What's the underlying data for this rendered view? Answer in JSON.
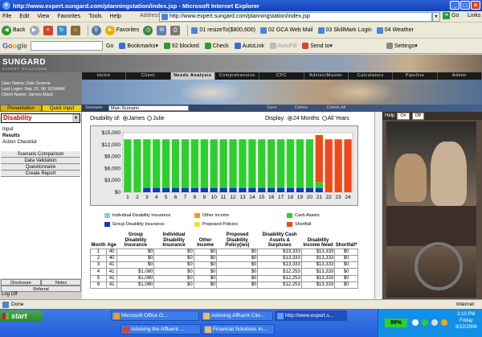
{
  "window": {
    "title": "http://www.expert.sungard.com/planningstation/index.jsp - Microsoft Internet Explorer"
  },
  "menu": [
    "File",
    "Edit",
    "View",
    "Favorites",
    "Tools",
    "Help"
  ],
  "address": {
    "label": "Address",
    "url": "http://www.expert.sungard.com/planningstation/index.jsp",
    "go": "Go",
    "links": "Links"
  },
  "toolbar": {
    "back": "Back",
    "favorites": "Favorites",
    "links": [
      "01 resizeTo($800,600)",
      "02 GCA Web Mail",
      "03 SkillMark Login",
      "04 Weather"
    ]
  },
  "googlebar": {
    "logo": [
      "G",
      "o",
      "o",
      "g",
      "l",
      "e"
    ],
    "go": "Go",
    "bookmarks": "Bookmarks▾",
    "blocked": "92 blocked",
    "check": "Check",
    "autolink": "AutoLink",
    "autofill": "AutoFill",
    "sendto": "Send to▾",
    "settings": "Settings▾"
  },
  "app": {
    "logo": "SUNGARD",
    "logo_sub": "EXPERT SOLUTIONS",
    "user": [
      "User Name: Dan Greene",
      "Last Login: Sep 22, 06 10:54AM",
      "Client Name: James Mack"
    ],
    "nav_tabs": [
      "Home",
      "Client",
      "Needs Analysis",
      "Comprehensive",
      "CPC",
      "AdvisorMaster",
      "Calculators",
      "Pipeline",
      "Admin"
    ],
    "active_nav": "Needs Analysis",
    "sub_tabs": {
      "presentation": "Presentation",
      "quick_input": "Quick Input"
    },
    "scenario": {
      "label": "Scenario",
      "value": "Main Scenario",
      "buttons": [
        "Save",
        "Delete",
        "Delete All"
      ]
    },
    "left_nav": {
      "module": "Disability",
      "items": [
        "Input",
        "Results",
        "Action Checklist"
      ],
      "buttons": [
        "Scenario Comparison",
        "Data Validation",
        "Questionnaire",
        "Create Report"
      ],
      "bottom": {
        "disclosure": "Disclosure",
        "notes": "Notes",
        "referral": "Referral",
        "logoff": "Log Off"
      }
    },
    "controls": {
      "disability_of": "Disability of:",
      "person1": "James",
      "person2": "Julie",
      "display": "Display:",
      "opt1": "24 Months",
      "opt2": "All Years"
    },
    "help": {
      "label": "Help",
      "on": "On",
      "off": "Off"
    }
  },
  "chart_data": {
    "type": "bar",
    "stacked": true,
    "categories": [
      "1",
      "2",
      "3",
      "4",
      "5",
      "6",
      "7",
      "8",
      "9",
      "10",
      "11",
      "12",
      "13",
      "14",
      "15",
      "16",
      "17",
      "18",
      "19",
      "20",
      "21",
      "22",
      "23",
      "24"
    ],
    "series": [
      {
        "name": "Individual Disability Insurance",
        "color": "#88c8f0",
        "values": [
          0,
          0,
          0,
          0,
          0,
          0,
          0,
          0,
          0,
          0,
          0,
          0,
          0,
          0,
          0,
          0,
          0,
          0,
          0,
          0,
          0,
          0,
          0,
          0
        ]
      },
      {
        "name": "Group Disability Insurance",
        "color": "#1038c0",
        "values": [
          0,
          0,
          1080,
          1080,
          1080,
          1080,
          1080,
          1080,
          1080,
          1080,
          1080,
          1080,
          1080,
          1080,
          1080,
          1080,
          1080,
          1080,
          1080,
          1080,
          1080,
          0,
          0,
          0
        ]
      },
      {
        "name": "Other Income",
        "color": "#e8a020",
        "values": [
          0,
          0,
          0,
          0,
          0,
          0,
          0,
          0,
          0,
          0,
          0,
          0,
          0,
          0,
          0,
          0,
          0,
          0,
          0,
          0,
          0,
          0,
          0,
          0
        ]
      },
      {
        "name": "Proposed Policies",
        "color": "#f0e040",
        "values": [
          0,
          0,
          0,
          0,
          0,
          0,
          0,
          0,
          0,
          0,
          0,
          0,
          0,
          0,
          0,
          0,
          0,
          0,
          0,
          0,
          0,
          0,
          0,
          0
        ]
      },
      {
        "name": "Cash Assets",
        "color": "#2cd02c",
        "values": [
          13333,
          13333,
          12253,
          12253,
          12253,
          12253,
          12253,
          12253,
          12253,
          12253,
          12253,
          12253,
          12253,
          12253,
          12253,
          12253,
          12253,
          12253,
          12253,
          12253,
          1500,
          0,
          0,
          0
        ]
      },
      {
        "name": "Shortfall",
        "color": "#f04818",
        "values": [
          0,
          0,
          0,
          0,
          0,
          0,
          0,
          0,
          0,
          0,
          0,
          0,
          0,
          0,
          0,
          0,
          0,
          0,
          0,
          0,
          11833,
          13333,
          13333,
          13333
        ]
      }
    ],
    "yticks": [
      "$15,000",
      "$12,000",
      "$9,000",
      "$6,000",
      "$3,000",
      "$0"
    ],
    "ylim": [
      0,
      15000
    ],
    "legend_position": "bottom",
    "grid": true,
    "table": {
      "headers": [
        "Month",
        "Age",
        "Group Disability Insurance",
        "Individual Disability Insurance",
        "Other Income",
        "Proposed Disability Policy(ies)",
        "Disability Cash Assets & Surpluses",
        "Disability Income Need",
        "Shortfall*"
      ],
      "rows": [
        [
          "1",
          "40",
          "$0",
          "$0",
          "$0",
          "$0",
          "$13,333",
          "$13,333",
          "$0"
        ],
        [
          "2",
          "40",
          "$0",
          "$0",
          "$0",
          "$0",
          "$13,333",
          "$13,333",
          "$0"
        ],
        [
          "3",
          "41",
          "$0",
          "$0",
          "$0",
          "$0",
          "$13,333",
          "$13,333",
          "$0"
        ],
        [
          "4",
          "41",
          "$1,080",
          "$0",
          "$0",
          "$0",
          "$12,253",
          "$13,333",
          "$0"
        ],
        [
          "5",
          "41",
          "$1,080",
          "$0",
          "$0",
          "$0",
          "$12,253",
          "$13,333",
          "$0"
        ],
        [
          "6",
          "41",
          "$1,080",
          "$0",
          "$0",
          "$0",
          "$12,253",
          "$13,333",
          "$0"
        ]
      ]
    }
  },
  "status": {
    "done": "Done",
    "zone": "Internet"
  },
  "taskbar": {
    "start": "start",
    "tasks": [
      "Microsoft Office O...",
      "Advising Affluent Clie...",
      "http://www.expert.s...",
      "Advising the Affluent ...",
      "Financial Solutions In..."
    ],
    "battery": "99%",
    "clock": [
      "3:10 PM",
      "Friday",
      "9/22/2006"
    ]
  }
}
